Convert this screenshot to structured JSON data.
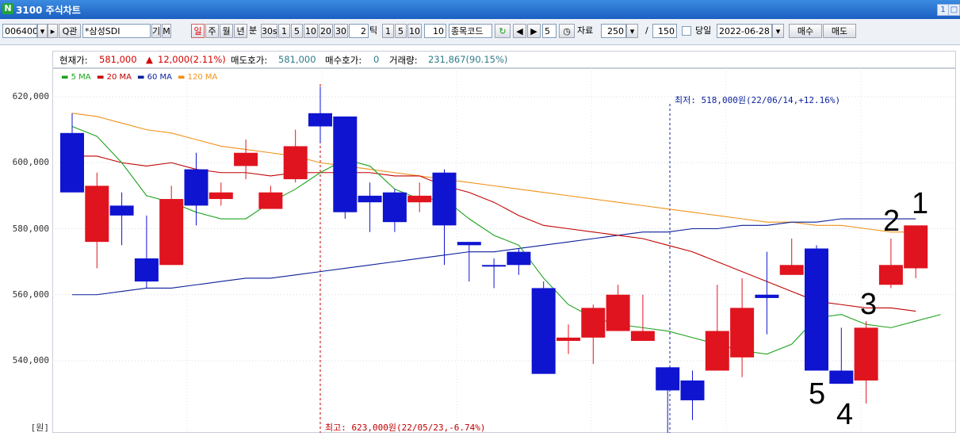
{
  "titlebar": {
    "app_icon_glyph": "N",
    "title": "3100 주식차트",
    "btn_restore": "1",
    "btn_max": "□"
  },
  "toolbar": {
    "code_value": "006400",
    "search_glyph": "Q",
    "search_label": "관",
    "stock_name": "*삼성SDI",
    "btn_gi": "기",
    "btn_m": "M",
    "period_buttons": [
      "일",
      "주",
      "월",
      "년"
    ],
    "period_active": "일",
    "unit_label": "분",
    "minute_select": "30s",
    "minute_buttons": [
      "1",
      "5",
      "10",
      "20",
      "30"
    ],
    "tick_value": "2",
    "tick_label": "틱",
    "tick_buttons": [
      "1",
      "5",
      "10"
    ],
    "tick_input": "10",
    "code_label": "종목코드",
    "spin_value": "5",
    "data_label": "자료",
    "data_count": "250",
    "slash": "/",
    "total_count": "150",
    "today_label": "당일",
    "date_value": "2022-06-28",
    "buy_label": "매수",
    "sell_label": "매도"
  },
  "info": {
    "price_label": "현재가:",
    "price_value": "581,000",
    "change_value": "12,000(2.11%)",
    "ask_label": "매도호가:",
    "ask_value": "581,000",
    "bid_label": "매수호가:",
    "bid_value": "0",
    "volume_label": "거래량:",
    "volume_value": "231,867(90.15%)"
  },
  "legend": [
    {
      "label": "5 MA",
      "color": "#1fa31f"
    },
    {
      "label": "20 MA",
      "color": "#c00000"
    },
    {
      "label": "60 MA",
      "color": "#0b1f9c"
    },
    {
      "label": "120 MA",
      "color": "#f0921a"
    }
  ],
  "yaxis": {
    "ticks": [
      "620,000",
      "600,000",
      "580,000",
      "560,000",
      "540,000"
    ],
    "unit": "[원]"
  },
  "annotations": {
    "low_text": "최저: 518,000원(22/06/14,+12.16%)",
    "high_text": "최고: 623,000원(22/05/23,-6.74%)"
  },
  "markers": [
    "1",
    "2",
    "3",
    "4",
    "5"
  ],
  "chart_data": {
    "type": "candlestick",
    "y_range": [
      528000,
      630000
    ],
    "y_ticks": [
      540000,
      560000,
      580000,
      600000,
      620000
    ],
    "colors": {
      "up": "#e0141e",
      "down": "#0f14d0",
      "ma5": "#1fa31f",
      "ma20": "#c00000",
      "ma60": "#0b1f9c",
      "ma120": "#f0921a"
    },
    "candles": [
      {
        "o": 609000,
        "h": 615000,
        "l": 599000,
        "c": 591000,
        "up": false
      },
      {
        "o": 576000,
        "h": 597000,
        "l": 568000,
        "c": 593000,
        "up": true
      },
      {
        "o": 587000,
        "h": 591000,
        "l": 575000,
        "c": 584000,
        "up": false
      },
      {
        "o": 571000,
        "h": 584000,
        "l": 562000,
        "c": 564000,
        "up": false
      },
      {
        "o": 569000,
        "h": 593000,
        "l": 569000,
        "c": 589000,
        "up": true
      },
      {
        "o": 598000,
        "h": 603000,
        "l": 581000,
        "c": 587000,
        "up": false
      },
      {
        "o": 589000,
        "h": 594000,
        "l": 587000,
        "c": 591000,
        "up": true
      },
      {
        "o": 599000,
        "h": 607000,
        "l": 595000,
        "c": 603000,
        "up": true
      },
      {
        "o": 586000,
        "h": 593000,
        "l": 586000,
        "c": 591000,
        "up": true
      },
      {
        "o": 595000,
        "h": 610000,
        "l": 594000,
        "c": 605000,
        "up": true
      },
      {
        "o": 615000,
        "h": 623000,
        "l": 606000,
        "c": 611000,
        "up": false
      },
      {
        "o": 614000,
        "h": 614000,
        "l": 583000,
        "c": 585000,
        "up": false
      },
      {
        "o": 590000,
        "h": 594000,
        "l": 579000,
        "c": 588000,
        "up": false
      },
      {
        "o": 591000,
        "h": 592000,
        "l": 579000,
        "c": 582000,
        "up": false
      },
      {
        "o": 588000,
        "h": 594000,
        "l": 585000,
        "c": 590000,
        "up": true
      },
      {
        "o": 597000,
        "h": 598000,
        "l": 569000,
        "c": 581000,
        "up": false
      },
      {
        "o": 576000,
        "h": 576000,
        "l": 564000,
        "c": 575000,
        "up": false
      },
      {
        "o": 569000,
        "h": 571000,
        "l": 562000,
        "c": 569000,
        "up": false
      },
      {
        "o": 573000,
        "h": 574000,
        "l": 566000,
        "c": 569000,
        "up": false
      },
      {
        "o": 562000,
        "h": 564000,
        "l": 536000,
        "c": 536000,
        "up": false
      },
      {
        "o": 547000,
        "h": 551000,
        "l": 542000,
        "c": 546000,
        "up": true
      },
      {
        "o": 547000,
        "h": 557000,
        "l": 539000,
        "c": 556000,
        "up": true
      },
      {
        "o": 549000,
        "h": 563000,
        "l": 549000,
        "c": 560000,
        "up": true
      },
      {
        "o": 546000,
        "h": 560000,
        "l": 546000,
        "c": 549000,
        "up": true
      },
      {
        "o": 538000,
        "h": 538000,
        "l": 518000,
        "c": 531000,
        "up": false
      },
      {
        "o": 534000,
        "h": 537000,
        "l": 522000,
        "c": 528000,
        "up": false
      },
      {
        "o": 537000,
        "h": 563000,
        "l": 537000,
        "c": 549000,
        "up": true
      },
      {
        "o": 541000,
        "h": 565000,
        "l": 535000,
        "c": 556000,
        "up": true
      },
      {
        "o": 560000,
        "h": 573000,
        "l": 548000,
        "c": 559000,
        "up": false
      },
      {
        "o": 566000,
        "h": 577000,
        "l": 566000,
        "c": 569000,
        "up": true
      },
      {
        "o": 574000,
        "h": 575000,
        "l": 537000,
        "c": 537000,
        "up": false
      },
      {
        "o": 537000,
        "h": 550000,
        "l": 533000,
        "c": 533000,
        "up": false
      },
      {
        "o": 534000,
        "h": 552000,
        "l": 527000,
        "c": 550000,
        "up": true
      },
      {
        "o": 563000,
        "h": 577000,
        "l": 562000,
        "c": 569000,
        "up": true
      },
      {
        "o": 568000,
        "h": 580000,
        "l": 565000,
        "c": 581000,
        "up": true
      }
    ],
    "ma5": [
      611000,
      608000,
      600000,
      590000,
      588000,
      585000,
      583000,
      583000,
      588000,
      592000,
      597000,
      601000,
      599000,
      592000,
      589000,
      589000,
      583000,
      578000,
      575000,
      565000,
      557000,
      553000,
      551000,
      550000,
      549000,
      547000,
      545000,
      543000,
      542000,
      545000,
      553000,
      554000,
      551000,
      550000,
      552000,
      554000
    ],
    "ma20": [
      602000,
      602000,
      600000,
      599000,
      600000,
      598000,
      597000,
      597000,
      596000,
      597000,
      597000,
      597000,
      597000,
      596000,
      596000,
      593000,
      591000,
      588000,
      584000,
      581000,
      580000,
      579000,
      578000,
      577000,
      575000,
      573000,
      570000,
      567000,
      564000,
      561000,
      558000,
      557000,
      556000,
      556000,
      555000
    ],
    "ma60": [
      560000,
      560000,
      561000,
      562000,
      562000,
      563000,
      564000,
      565000,
      565000,
      566000,
      567000,
      568000,
      569000,
      570000,
      571000,
      572000,
      573000,
      573000,
      574000,
      575000,
      576000,
      577000,
      578000,
      579000,
      579000,
      580000,
      580000,
      581000,
      581000,
      582000,
      582000,
      583000,
      583000,
      583000,
      583000
    ],
    "ma120": [
      615000,
      614000,
      612000,
      610000,
      609000,
      607000,
      605000,
      604000,
      603000,
      602000,
      600000,
      599000,
      598000,
      597000,
      596000,
      595000,
      594000,
      593000,
      592000,
      591000,
      590000,
      589000,
      588000,
      587000,
      586000,
      585000,
      584000,
      583000,
      582000,
      582000,
      581000,
      581000,
      580000,
      579000,
      579000
    ]
  }
}
